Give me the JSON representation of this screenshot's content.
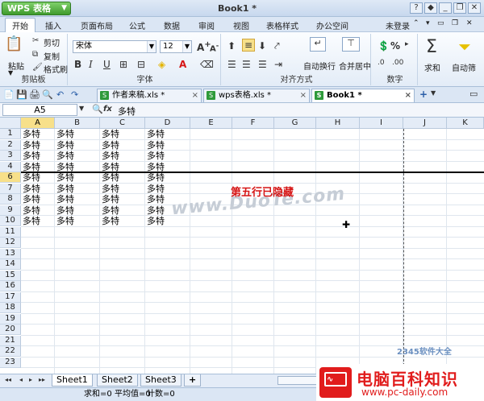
{
  "app": {
    "name": "WPS 表格",
    "doc_title": "Book1 *",
    "login": "未登录"
  },
  "menu": [
    "开始",
    "插入",
    "页面布局",
    "公式",
    "数据",
    "审阅",
    "视图",
    "表格样式",
    "办公空间"
  ],
  "ribbon": {
    "clipboard": {
      "paste": "粘贴",
      "cut": "剪切",
      "copy": "复制",
      "format_painter": "格式刷",
      "label": "剪贴板"
    },
    "font": {
      "name": "宋体",
      "size": "12",
      "bold": "B",
      "italic": "I",
      "underline": "U",
      "label": "字体"
    },
    "alignment": {
      "wrap": "自动换行",
      "merge": "合并居中",
      "label": "对齐方式"
    },
    "number": {
      "percent": "%",
      "label": "数字"
    },
    "editing": {
      "sum": "求和",
      "filter": "自动筛"
    }
  },
  "doc_tabs": [
    {
      "name": "作者来稿.xls *",
      "active": false
    },
    {
      "name": "wps表格.xls *",
      "active": false
    },
    {
      "name": "Book1 *",
      "active": true
    }
  ],
  "formula_bar": {
    "cell_ref": "A5",
    "fx": "fx",
    "value": "多特"
  },
  "columns": [
    "A",
    "B",
    "C",
    "D",
    "E",
    "F",
    "G",
    "H",
    "I",
    "J",
    "K"
  ],
  "rows": [
    "1",
    "2",
    "3",
    "4",
    "6",
    "7",
    "8",
    "9",
    "10",
    "11",
    "12",
    "13",
    "14",
    "15",
    "16",
    "17",
    "18",
    "19",
    "20",
    "21",
    "22",
    "23"
  ],
  "cell_text": "多特",
  "annotation": "第五行已隐藏",
  "watermark": "www.DuoTe.com",
  "sheets": [
    "Sheet1",
    "Sheet2",
    "Sheet3",
    "+"
  ],
  "status": {
    "sum": "求和=0",
    "avg": "平均值=0",
    "count": "计数=0"
  },
  "brand": {
    "title": "电脑百科知识",
    "url": "www.pc-daily.com",
    "corner_watermark": "2345软件大全"
  },
  "colors": {
    "accent": "#3f9a2d",
    "brand_red": "#e11c1c",
    "selected_header": "#f7e08a"
  }
}
